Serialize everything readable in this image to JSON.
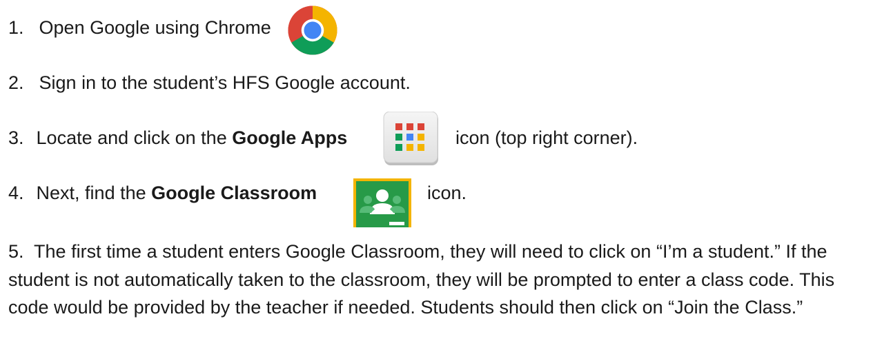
{
  "steps": [
    {
      "num": "1.",
      "text": "Open Google using Chrome"
    },
    {
      "num": "2.",
      "text": "Sign in to the student’s HFS Google account."
    },
    {
      "num": "3.",
      "pre": "Locate and click on the ",
      "bold": "Google Apps",
      "post": "icon (top right corner)."
    },
    {
      "num": "4.",
      "pre": "Next, find the ",
      "bold": "Google Classroom",
      "post": "icon."
    },
    {
      "num": "5.",
      "text": "The first time a student enters Google Classroom, they will need to click on “I’m a student.”  If the student is not automatically taken to the classroom, they will be prompted to enter a class code.  This code would be provided by the teacher if needed.  Students should then click on “Join the Class.”"
    }
  ],
  "icons": {
    "chrome": "chrome-icon",
    "apps": "google-apps-icon",
    "classroom": "google-classroom-icon"
  }
}
